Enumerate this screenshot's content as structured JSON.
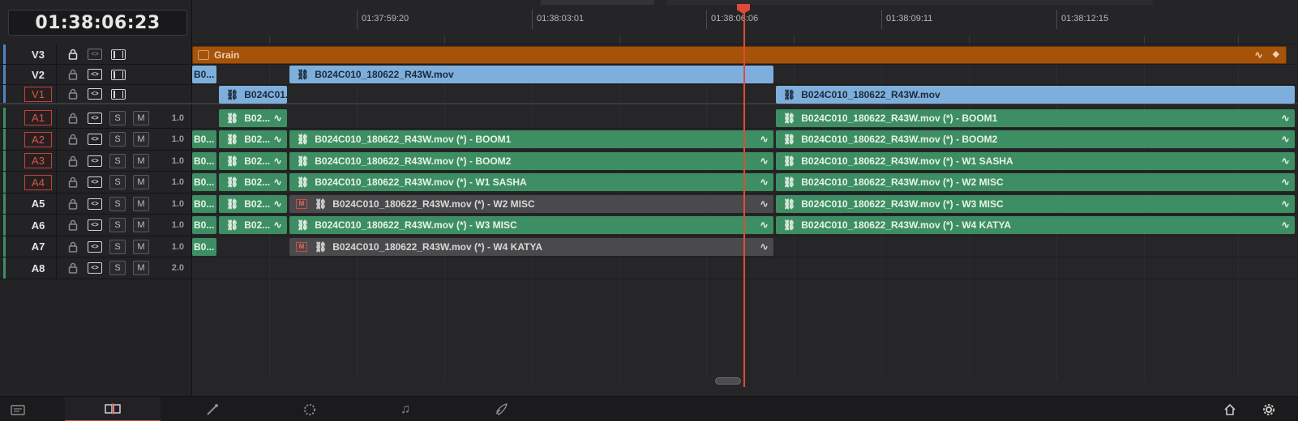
{
  "timecode": "01:38:06:23",
  "ruler": {
    "labels": [
      "01:37:59:20",
      "01:38:03:01",
      "01:38:06:06",
      "01:38:09:11",
      "01:38:12:15"
    ]
  },
  "tracks": [
    {
      "name": "V3",
      "kind": "video",
      "armed": false,
      "locked": true
    },
    {
      "name": "V2",
      "kind": "video",
      "armed": false,
      "locked": false
    },
    {
      "name": "V1",
      "kind": "video",
      "armed": true,
      "locked": false
    },
    {
      "name": "A1",
      "kind": "audio",
      "armed": true,
      "volume": "1.0"
    },
    {
      "name": "A2",
      "kind": "audio",
      "armed": true,
      "volume": "1.0"
    },
    {
      "name": "A3",
      "kind": "audio",
      "armed": true,
      "volume": "1.0"
    },
    {
      "name": "A4",
      "kind": "audio",
      "armed": true,
      "volume": "1.0"
    },
    {
      "name": "A5",
      "kind": "audio",
      "armed": false,
      "volume": "1.0"
    },
    {
      "name": "A6",
      "kind": "audio",
      "armed": false,
      "volume": "1.0"
    },
    {
      "name": "A7",
      "kind": "audio",
      "armed": false,
      "volume": "1.0"
    },
    {
      "name": "A8",
      "kind": "audio",
      "armed": false,
      "volume": "2.0"
    }
  ],
  "solo_label": "S",
  "mute_label": "M",
  "clips": {
    "grain": "Grain",
    "v2_a": "B0...",
    "v2_b": "B024C010_180622_R43W.mov",
    "v1_a": "B024C01...",
    "v1_b": "B024C010_180622_R43W.mov",
    "a1_a": "B02...",
    "a1_b": "B024C010_180622_R43W.mov (*) - BOOM1",
    "a2_a": "B0...",
    "a2_b": "B02...",
    "a2_c": "B024C010_180622_R43W.mov (*) - BOOM1",
    "a2_d": "B024C010_180622_R43W.mov (*) - BOOM2",
    "a3_a": "B0...",
    "a3_b": "B02...",
    "a3_c": "B024C010_180622_R43W.mov (*) - BOOM2",
    "a3_d": "B024C010_180622_R43W.mov (*) - W1 SASHA",
    "a4_a": "B0...",
    "a4_b": "B02...",
    "a4_c": "B024C010_180622_R43W.mov (*) - W1 SASHA",
    "a4_d": "B024C010_180622_R43W.mov (*) - W2 MISC",
    "a5_a": "B0...",
    "a5_b": "B02...",
    "a5_c": "B024C010_180622_R43W.mov (*) - W2 MISC",
    "a5_d": "B024C010_180622_R43W.mov (*) - W3 MISC",
    "a6_a": "B0...",
    "a6_b": "B02...",
    "a6_c": "B024C010_180622_R43W.mov (*) - W3 MISC",
    "a6_d": "B024C010_180622_R43W.mov (*) - W4 KATYA",
    "a7_a": "B0...",
    "a7_c": "B024C010_180622_R43W.mov (*) - W4 KATYA"
  },
  "clip_badges": {
    "muted": "M"
  },
  "icons": {
    "lock": "lock-icon",
    "link": "link-icon",
    "waveform": "waveform-icon",
    "home": "home-icon",
    "settings": "gear-icon"
  },
  "colors": {
    "video_clip": "#7eafdc",
    "audio_clip": "#3d8f63",
    "adjustment_clip": "#a5520a",
    "playhead": "#e04a3a",
    "armed": "#c2433a"
  },
  "pages": [
    "media",
    "edit",
    "color",
    "fusion",
    "fairlight",
    "deliver"
  ],
  "active_page": "edit"
}
